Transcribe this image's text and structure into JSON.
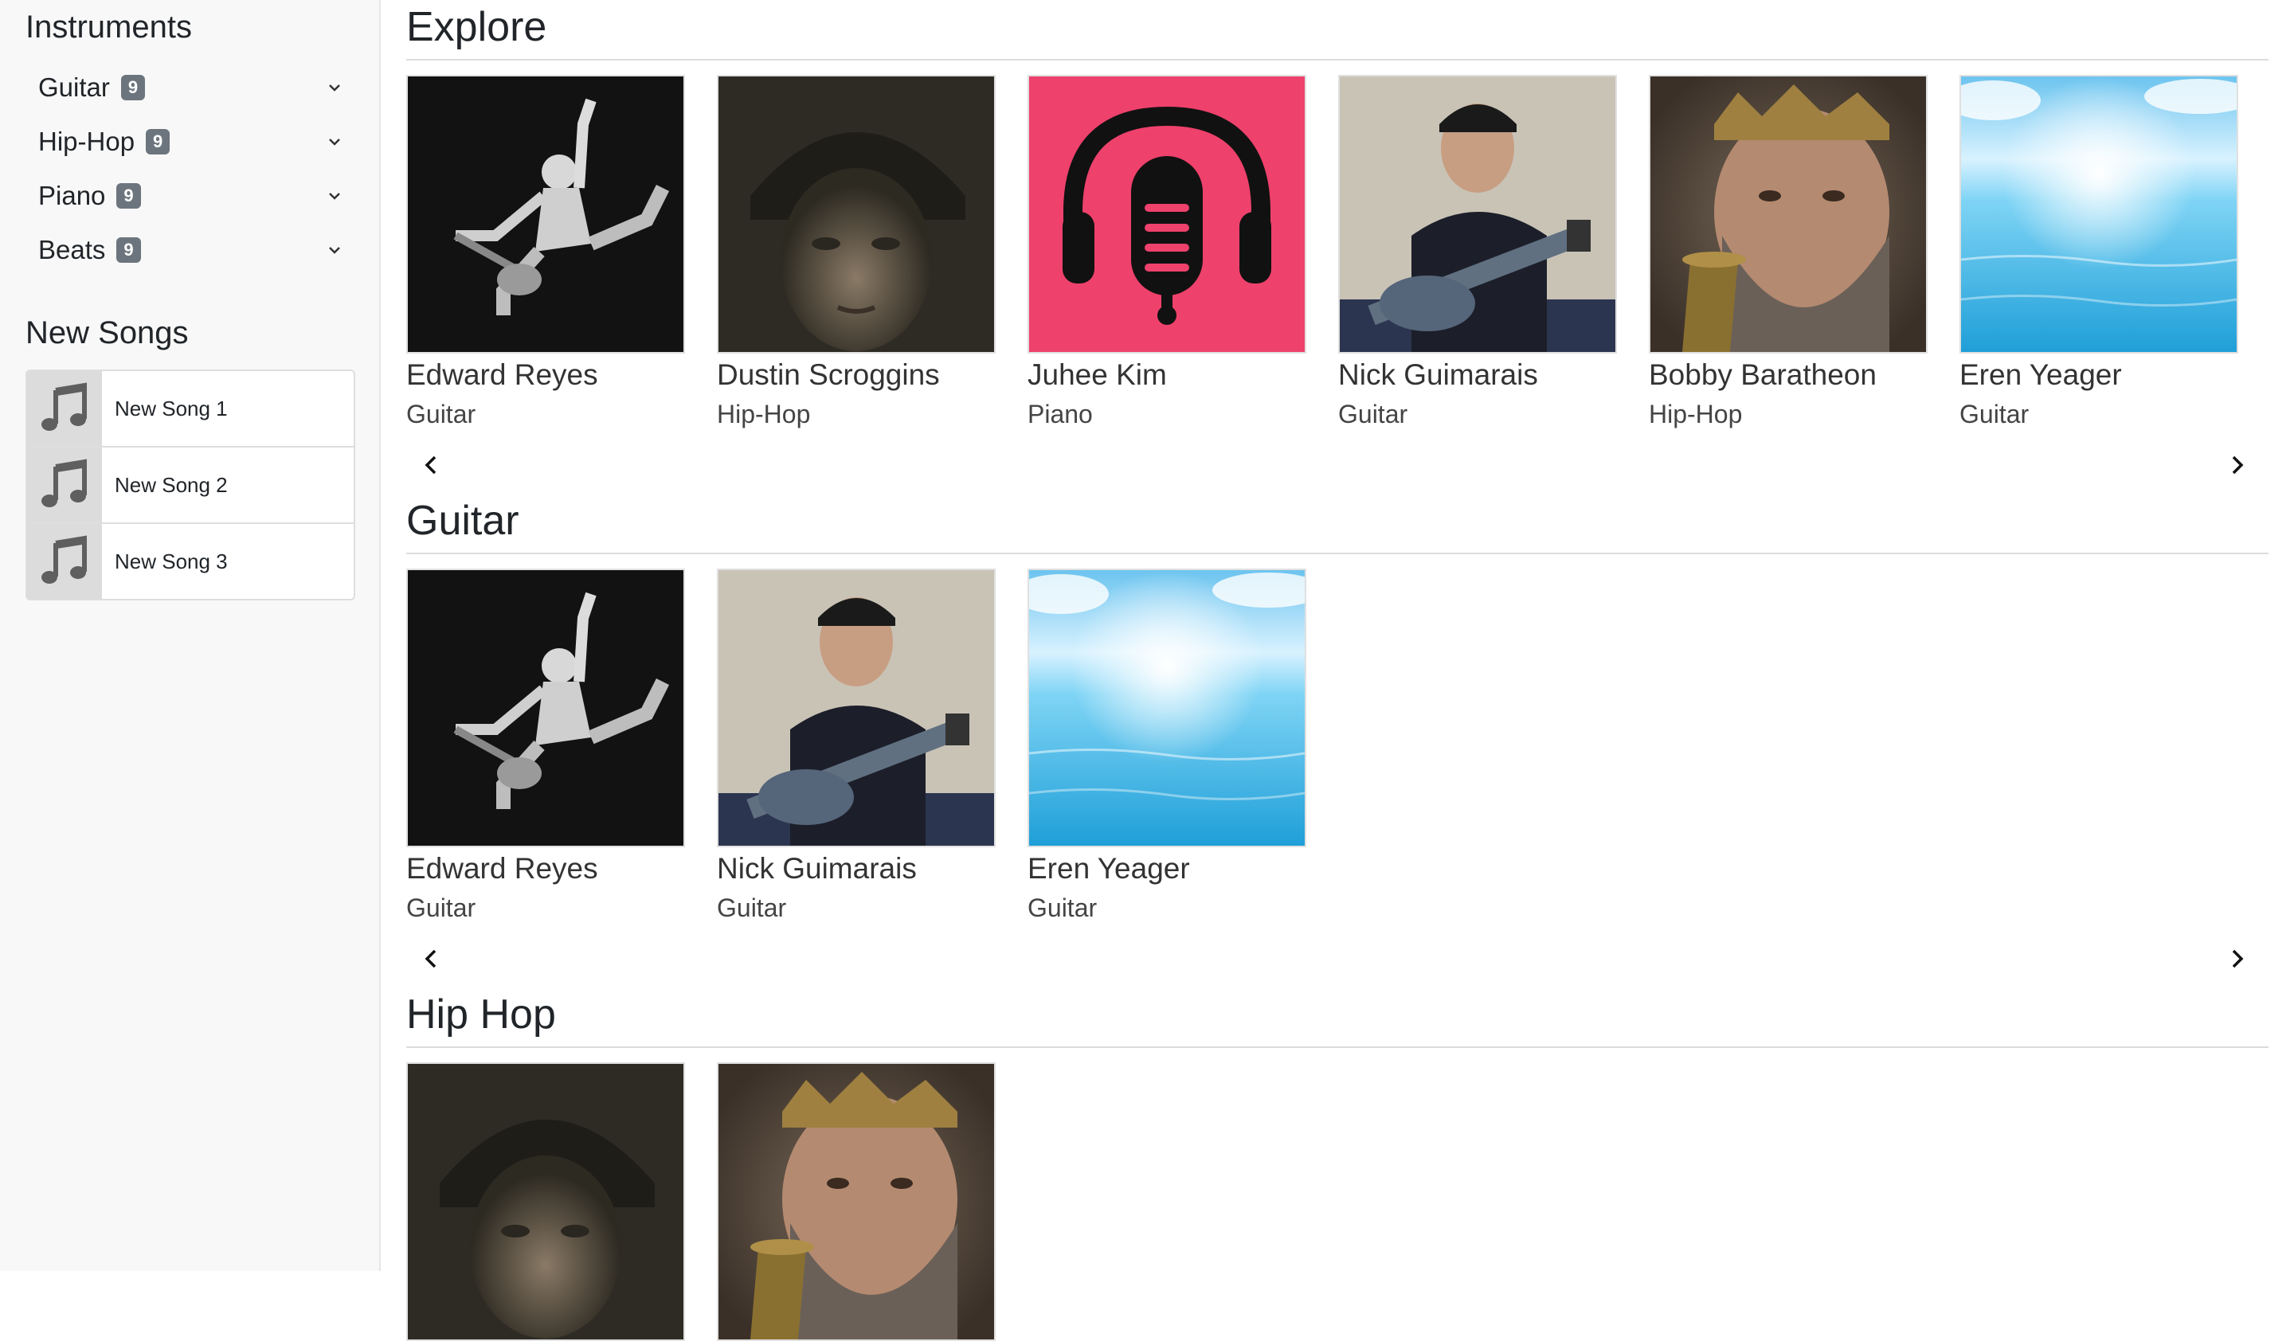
{
  "sidebar": {
    "instruments_heading": "Instruments",
    "instruments": [
      {
        "label": "Guitar",
        "count": "9"
      },
      {
        "label": "Hip-Hop",
        "count": "9"
      },
      {
        "label": "Piano",
        "count": "9"
      },
      {
        "label": "Beats",
        "count": "9"
      }
    ],
    "new_songs_heading": "New Songs",
    "new_songs": [
      {
        "label": "New Song 1"
      },
      {
        "label": "New Song 2"
      },
      {
        "label": "New Song 3"
      }
    ]
  },
  "sections": [
    {
      "title": "Explore",
      "cards": [
        {
          "name": "Edward Reyes",
          "genre": "Guitar",
          "image": "jumping-guitarist"
        },
        {
          "name": "Dustin Scroggins",
          "genre": "Hip-Hop",
          "image": "painted-portrait"
        },
        {
          "name": "Juhee Kim",
          "genre": "Piano",
          "image": "headphones-mic-logo"
        },
        {
          "name": "Nick Guimarais",
          "genre": "Guitar",
          "image": "man-with-guitar"
        },
        {
          "name": "Bobby Baratheon",
          "genre": "Hip-Hop",
          "image": "bearded-king"
        },
        {
          "name": "Eren Yeager",
          "genre": "Guitar",
          "image": "ocean"
        }
      ]
    },
    {
      "title": "Guitar",
      "cards": [
        {
          "name": "Edward Reyes",
          "genre": "Guitar",
          "image": "jumping-guitarist"
        },
        {
          "name": "Nick Guimarais",
          "genre": "Guitar",
          "image": "man-with-guitar"
        },
        {
          "name": "Eren Yeager",
          "genre": "Guitar",
          "image": "ocean"
        }
      ]
    },
    {
      "title": "Hip Hop",
      "cards": [
        {
          "name": "",
          "genre": "",
          "image": "painted-portrait"
        },
        {
          "name": "",
          "genre": "",
          "image": "bearded-king"
        }
      ]
    }
  ],
  "colors": {
    "accent_pink": "#ee416c",
    "badge_gray": "#6c757d",
    "sidebar_bg": "#f8f8f8"
  },
  "icons": {
    "collapse": "chevron-down-icon",
    "song": "music-note-icon",
    "prev": "chevron-left-icon",
    "next": "chevron-right-icon"
  }
}
